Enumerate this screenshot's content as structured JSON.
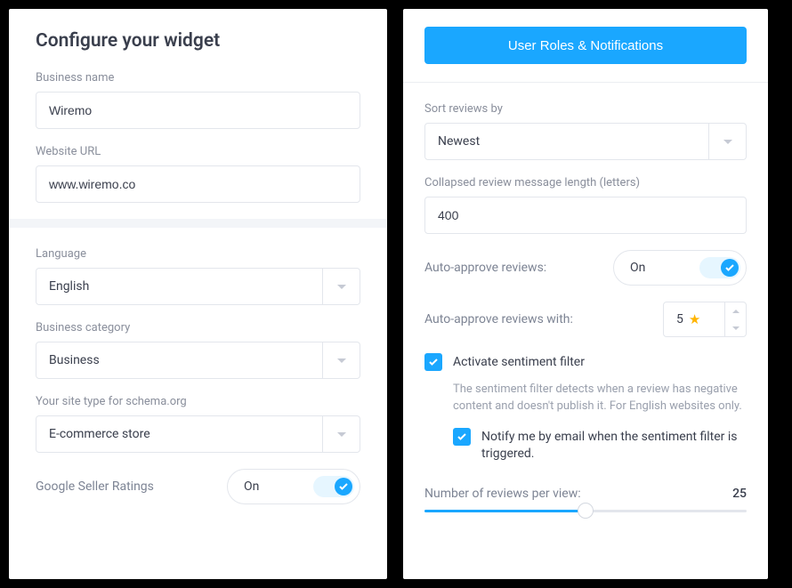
{
  "left": {
    "title": "Configure your widget",
    "business_name_label": "Business name",
    "business_name_value": "Wiremo",
    "website_url_label": "Website URL",
    "website_url_value": "www.wiremo.co",
    "language_label": "Language",
    "language_value": "English",
    "category_label": "Business category",
    "category_value": "Business",
    "site_type_label": "Your site type for schema.org",
    "site_type_value": "E-commerce store",
    "seller_ratings_label": "Google Seller Ratings",
    "seller_ratings_state": "On"
  },
  "right": {
    "button_user_roles": "User Roles & Notifications",
    "sort_label": "Sort reviews by",
    "sort_value": "Newest",
    "collapsed_label": "Collapsed review message length (letters)",
    "collapsed_value": "400",
    "auto_approve_label": "Auto-approve reviews:",
    "auto_approve_state": "On",
    "auto_approve_with_label": "Auto-approve reviews with:",
    "auto_approve_with_value": "5",
    "sentiment_label": "Activate sentiment filter",
    "sentiment_desc": "The sentiment filter detects when a review has negative content and doesn't publish it. For English websites only.",
    "notify_label": "Notify me by email when the sentiment filter is triggered.",
    "reviews_per_view_label": "Number of reviews per view:",
    "reviews_per_view_value": "25"
  }
}
